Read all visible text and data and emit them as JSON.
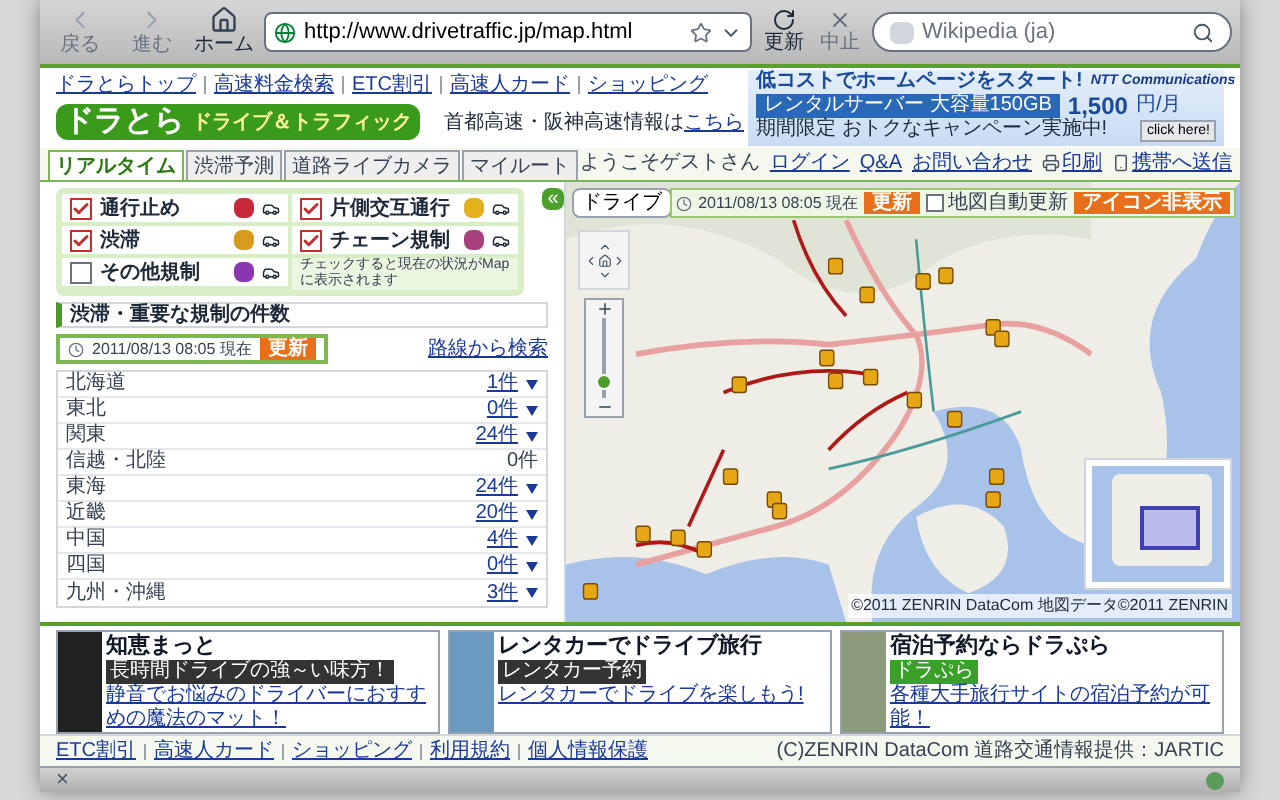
{
  "browser": {
    "nav_buttons": [
      {
        "label": "戻る",
        "disabled": true
      },
      {
        "label": "進む",
        "disabled": true
      },
      {
        "label": "ホーム",
        "disabled": false
      }
    ],
    "url": "http://www.drivetraffic.jp/map.html",
    "actions": [
      {
        "label": "更新",
        "disabled": false
      },
      {
        "label": "中止",
        "disabled": true
      }
    ],
    "search": {
      "placeholder": "Wikipedia (ja)"
    }
  },
  "header": {
    "top_links": [
      "ドラとらトップ",
      "高速料金検索",
      "ETC割引",
      "高速人カード",
      "ショッピング"
    ],
    "logo": {
      "main": "ドラとら",
      "sub": "ドライブ＆トラフィック"
    },
    "notice": {
      "text": "首都高速・阪神高速情報は",
      "link": "こちら"
    },
    "ad": {
      "headline": "低コストでホームページをスタート!",
      "product": "レンタルサーバー 大容量150GB",
      "price": "1,500",
      "unit": "円/月",
      "brand": "NTT Communications",
      "campaign": "期間限定 おトクなキャンペーン実施中!",
      "button": "click here!"
    }
  },
  "tabs": [
    {
      "label": "リアルタイム",
      "selected": true
    },
    {
      "label": "渋滞予測",
      "selected": false
    },
    {
      "label": "道路ライブカメラ",
      "selected": false
    },
    {
      "label": "マイルート",
      "selected": false
    }
  ],
  "drive_button": "ドライブ",
  "collapse_button": "«",
  "filters": [
    {
      "label": "通行止め",
      "checked": true,
      "color": "#c8283a"
    },
    {
      "label": "片側交互通行",
      "checked": true,
      "color": "#e2b21e"
    },
    {
      "label": "渋滞",
      "checked": true,
      "color": "#d89a1a"
    },
    {
      "label": "チェーン規制",
      "checked": true,
      "color": "#a8407c"
    },
    {
      "label": "その他規制",
      "checked": false,
      "color": "#8a36b0"
    }
  ],
  "filter_note": "チェックすると現在の状況がMapに表示されます",
  "counts": {
    "title": "渋滞・重要な規制の件数",
    "timestamp": "2011/08/13 08:05 現在",
    "refresh": "更新",
    "route_search": "路線から検索",
    "rows": [
      {
        "region": "北海道",
        "count": "1件",
        "linked": true
      },
      {
        "region": "東北",
        "count": "0件",
        "linked": true
      },
      {
        "region": "関東",
        "count": "24件",
        "linked": true
      },
      {
        "region": "信越・北陸",
        "count": "0件",
        "linked": false
      },
      {
        "region": "東海",
        "count": "24件",
        "linked": true
      },
      {
        "region": "近畿",
        "count": "20件",
        "linked": true
      },
      {
        "region": "中国",
        "count": "4件",
        "linked": true
      },
      {
        "region": "四国",
        "count": "0件",
        "linked": true
      },
      {
        "region": "九州・沖縄",
        "count": "3件",
        "linked": true
      }
    ]
  },
  "map": {
    "greeting": "ようこそゲストさん",
    "links": [
      {
        "label": "ログイン",
        "kind": "plain"
      },
      {
        "label": "Q&A",
        "kind": "plain"
      },
      {
        "label": "お問い合わせ",
        "kind": "plain"
      },
      {
        "label": "印刷",
        "kind": "print"
      },
      {
        "label": "携帯へ送信",
        "kind": "mobile"
      }
    ],
    "status": {
      "timestamp": "2011/08/13 08:05 現在",
      "refresh": "更新",
      "auto_update": {
        "label": "地図自動更新",
        "checked": false
      },
      "hide_icons": "アイコン非表示"
    },
    "zoom": {
      "level": 0.2
    },
    "copyright": "©2011 ZENRIN DataCom 地図データ©2011 ZENRIN"
  },
  "ads": [
    {
      "title": "知恵まっと",
      "tag": "長時間ドライブの強～い味方！",
      "text": "静音でお悩みのドライバーにおすすめの魔法のマット！"
    },
    {
      "title": "レンタカーでドライブ旅行",
      "tag": "レンタカー予約",
      "text": "レンタカーでドライブを楽しもう!"
    },
    {
      "title": "宿泊予約ならドラぷら",
      "tag": "ドラぷら",
      "text": "各種大手旅行サイトの宿泊予約が可能！"
    }
  ],
  "footer": {
    "links": [
      "ETC割引",
      "高速人カード",
      "ショッピング",
      "利用規約",
      "個人情報保護"
    ],
    "credit": "(C)ZENRIN DataCom 道路交通情報提供：JARTIC"
  },
  "status_bar": {
    "close": "×"
  }
}
